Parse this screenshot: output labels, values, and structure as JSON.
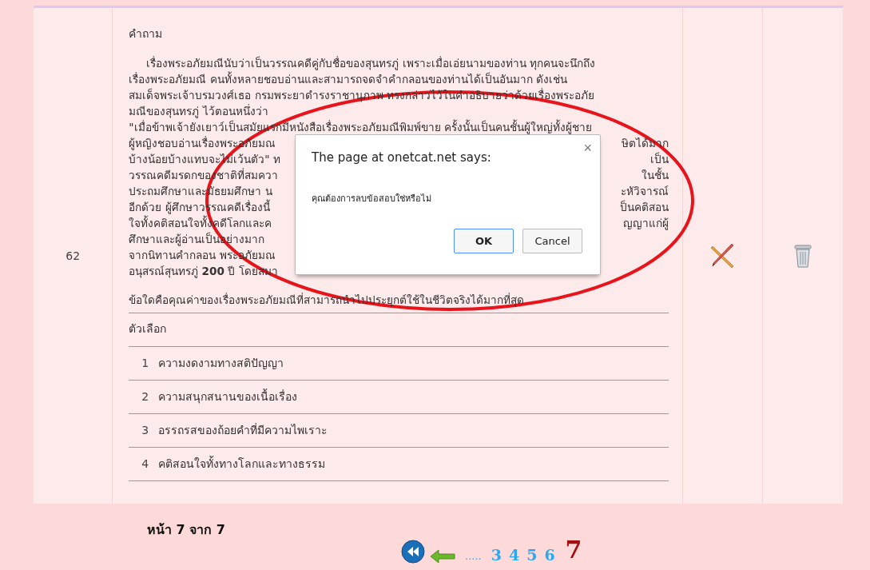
{
  "row": {
    "number": "62",
    "question_label": "คำถาม",
    "passage_lines": [
      {
        "indent": true,
        "left": "เรื่องพระอภัยมณีนับว่าเป็นวรรณคดีคู่กับชื่อของสุนทรภู่ เพราะเมื่อเอ่ยนามของท่าน ทุกคนจะนึกถึง"
      },
      {
        "indent": false,
        "left": "เรื่องพระอภัยมณี คนทั้งหลายชอบอ่านและสามารถจดจำคำกลอนของท่านได้เป็นอันมาก ดังเช่น"
      },
      {
        "indent": false,
        "left": "สมเด็จพระเจ้าบรมวงศ์เธอ กรมพระยาดำรงราชานุภาพ ทรงกล่าวไว้ในคำอธิบายว่าด้วยเรื่องพระอภัย"
      },
      {
        "indent": false,
        "left": "มณีของสุนทรภู่ ไว้ตอนหนึ่งว่า"
      },
      {
        "indent": false,
        "left": "\"เมื่อข้าพเจ้ายังเยาว์เป็นสมัยแรกมีหนังสือเรื่องพระอภัยมณีพิมพ์ขาย ครั้งนั้นเป็นคนชั้นผู้ใหญ่ทั้งผู้ชาย"
      },
      {
        "indent": false,
        "left": "ผู้หญิงชอบอ่านเรื่องพระอภัยมณ",
        "right": "ษิตได้มาก"
      },
      {
        "indent": false,
        "left": "บ้างน้อยบ้างแทบจะไม่เว้นตัว\" ท",
        "right": "เป็น"
      },
      {
        "indent": false,
        "left": "วรรณคดีมรดกของชาติที่สมควา",
        "right": "ในชั้น"
      },
      {
        "indent": false,
        "left": "ประถมศึกษาและมัธยมศึกษา น",
        "right": "ะหัวิจารณ์"
      },
      {
        "indent": false,
        "left": "อีกด้วย ผู้ศึกษาวรรณคดีเรื่องนี้",
        "right": "ป็นคติสอน"
      },
      {
        "indent": false,
        "left": "ใจทั้งคติสอนใจทั้งคดีโลกและค",
        "right": "ญญาแก่ผู้"
      },
      {
        "indent": false,
        "left": "ศึกษาและผู้อ่านเป็นอย่างมาก"
      },
      {
        "indent": false,
        "left": "จากนิทานคำกลอน พระอภัยมณ"
      },
      {
        "indent": false,
        "left": "อนุสรณ์สุนทรภู่ **200** ปี โดยสมา"
      }
    ],
    "question": "ข้อใดคือคุณค่าของเรื่องพระอภัยมณีที่สามารถนำไปประยุกต์ใช้ในชีวิตจริงได้มากที่สุด",
    "choices_label": "ตัวเลือก",
    "choices": [
      {
        "number": "1",
        "text": "ความงดงามทางสติปัญญา"
      },
      {
        "number": "2",
        "text": "ความสนุกสนานของเนื้อเรื่อง"
      },
      {
        "number": "3",
        "text": "อรรถรสของถ้อยคำที่มีความไพเราะ"
      },
      {
        "number": "4",
        "text": "คติสอนใจทั้งทางโลกและทางธรรม"
      }
    ]
  },
  "dialog": {
    "title": "The page at onetcat.net says:",
    "close": "×",
    "message": "คุณต้องการลบข้อสอบใช่หรือไม่",
    "buttons": [
      {
        "label": "OK",
        "selected": true
      },
      {
        "label": "Cancel",
        "selected": false
      }
    ]
  },
  "footer": {
    "page_info": "หน้า 7 จาก 7",
    "ellipsis": ".....",
    "pages": [
      {
        "label": "3",
        "selected": false
      },
      {
        "label": "4",
        "selected": false
      },
      {
        "label": "5",
        "selected": false
      },
      {
        "label": "6",
        "selected": false
      },
      {
        "label": "7",
        "selected": true
      }
    ]
  }
}
